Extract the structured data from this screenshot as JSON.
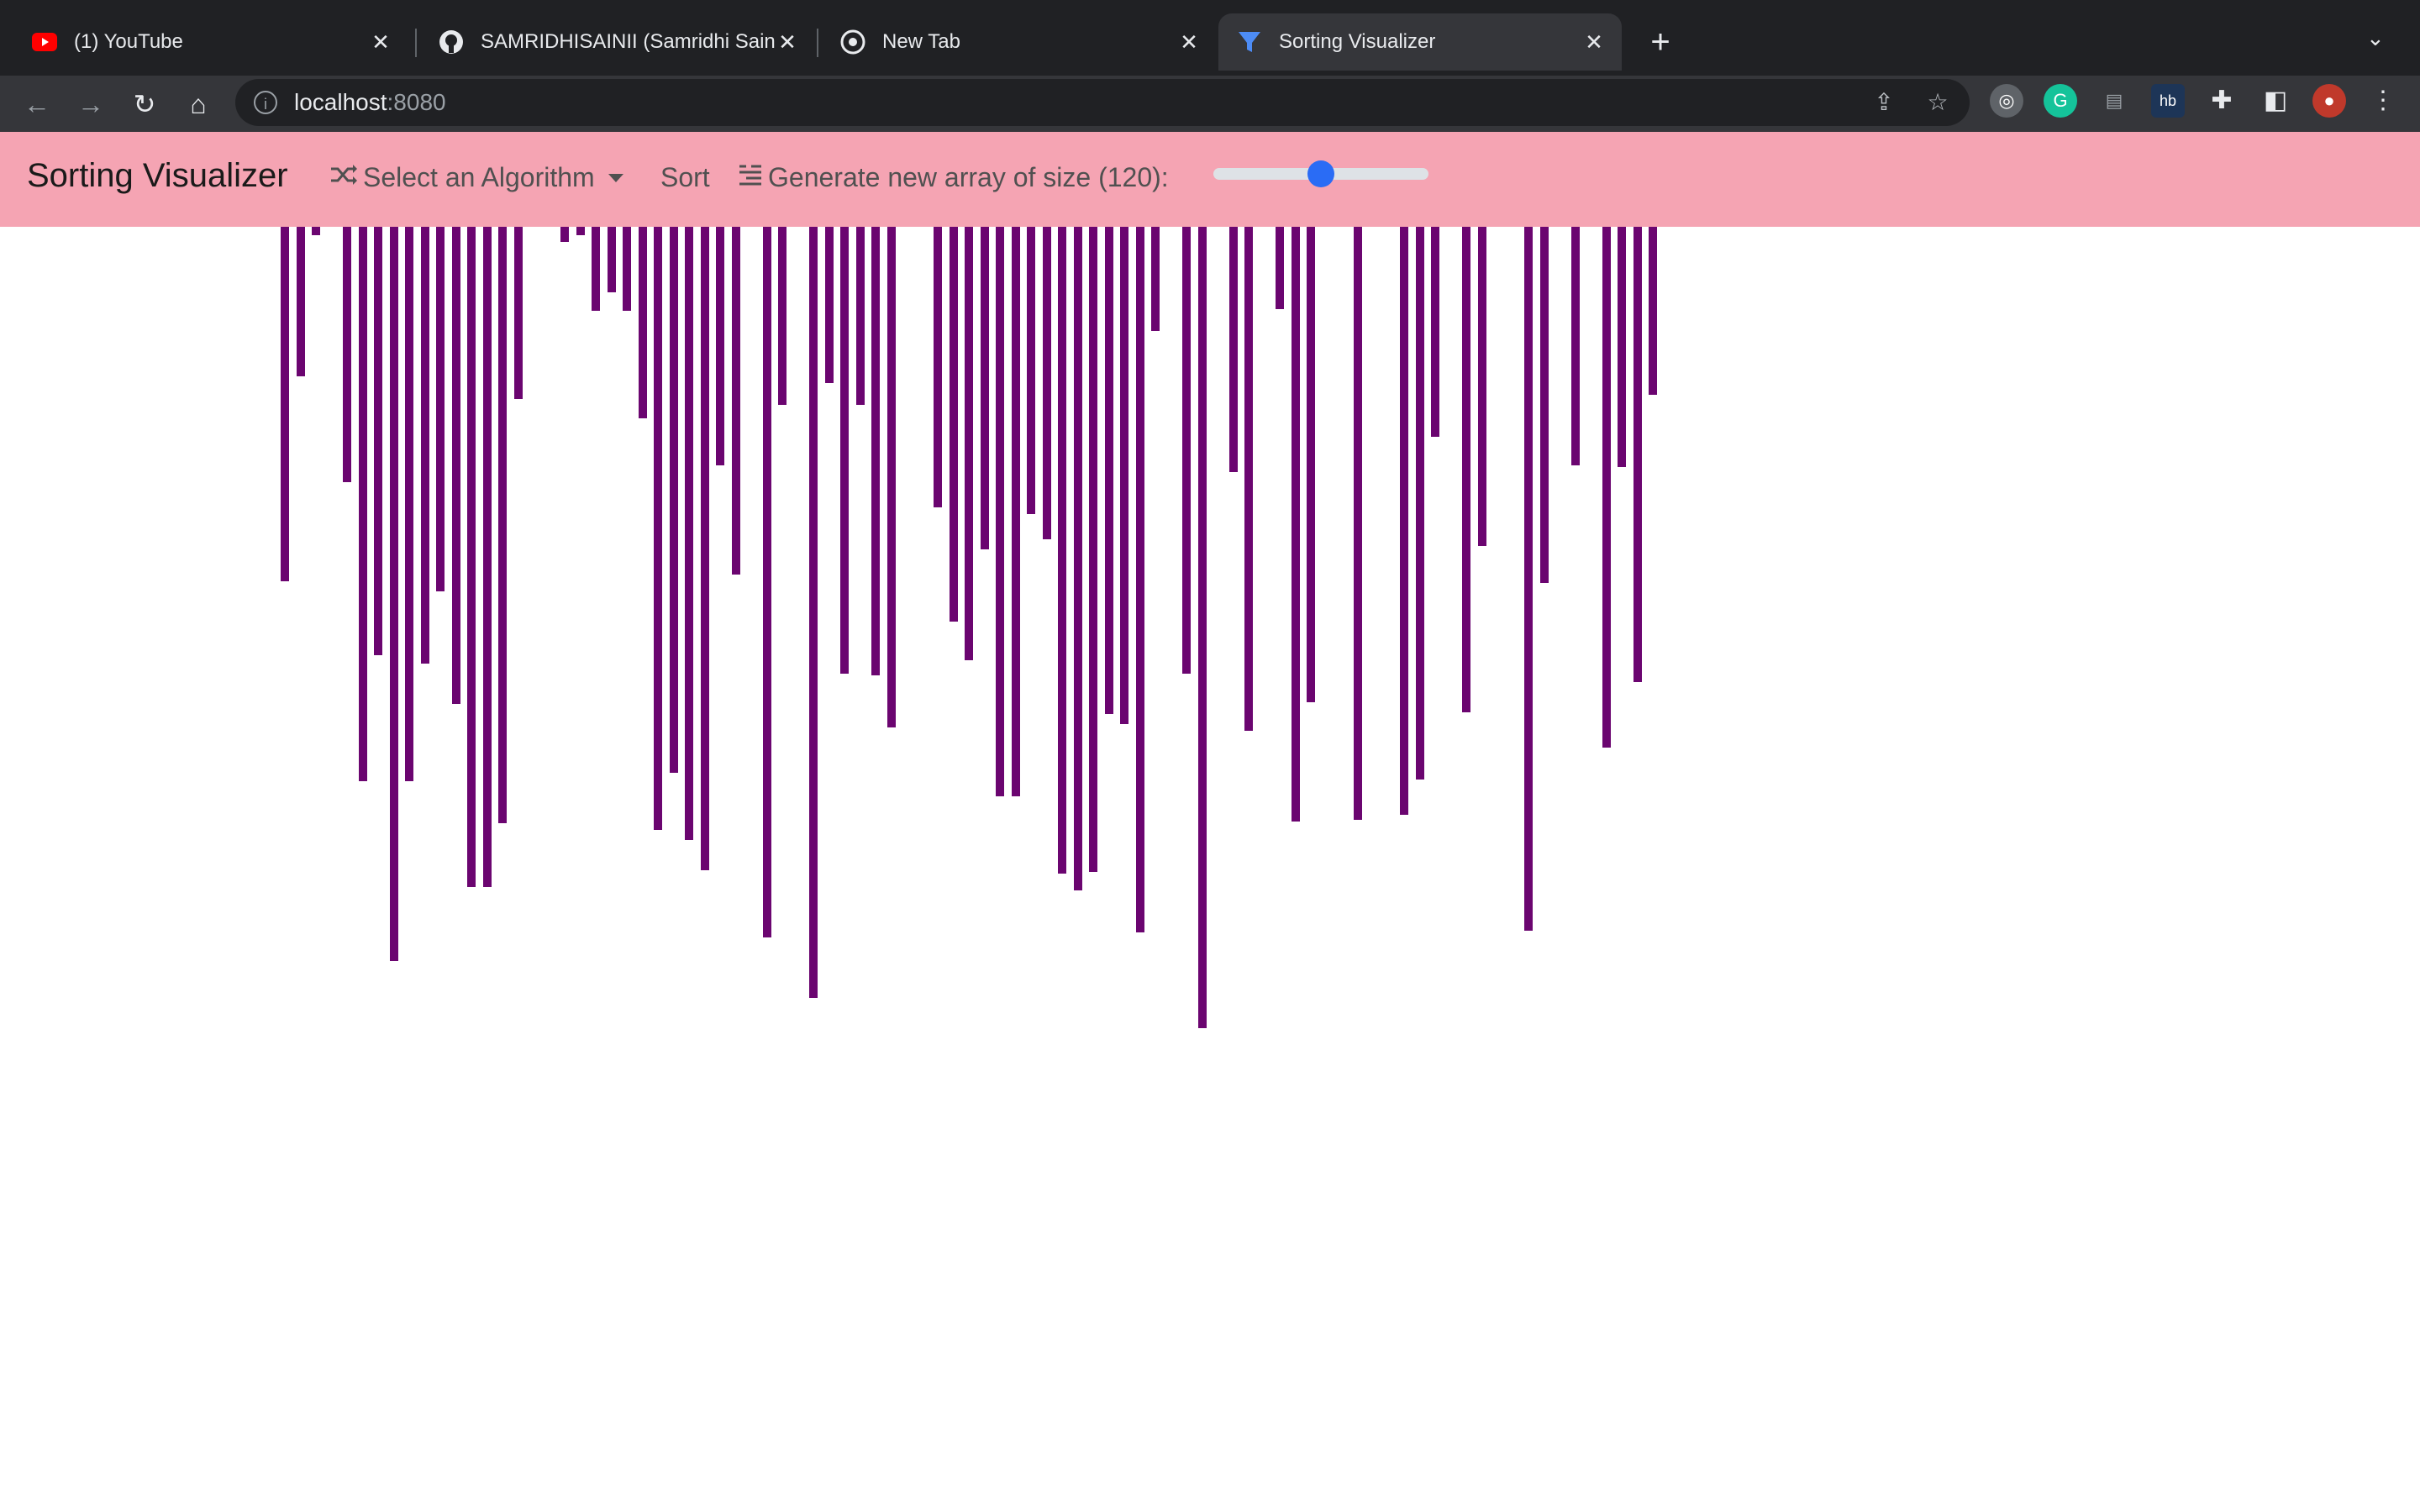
{
  "browser": {
    "tabs": [
      {
        "title": "(1) YouTube",
        "icon": "youtube-icon"
      },
      {
        "title": "SAMRIDHISAINII (Samridhi Saini)",
        "icon": "github-icon"
      },
      {
        "title": "New Tab",
        "icon": "chrome-icon"
      },
      {
        "title": "Sorting Visualizer",
        "icon": "funnel-icon"
      }
    ],
    "active_tab": 3,
    "url_host": "localhost",
    "url_port": ":8080"
  },
  "app": {
    "brand": "Sorting Visualizer",
    "algorithm_label": "Select an Algorithm",
    "sort_label": "Sort",
    "generate_label": "Generate new array of size (120):",
    "array_size": 120,
    "slider_fraction": 0.5,
    "bar_color": "#6b0570",
    "navbar_color": "#f5a4b3",
    "bar_values": [
      422,
      178,
      10,
      0,
      304,
      660,
      510,
      874,
      660,
      520,
      434,
      568,
      786,
      786,
      710,
      205,
      0,
      0,
      18,
      10,
      100,
      78,
      100,
      228,
      718,
      650,
      730,
      766,
      284,
      414,
      0,
      846,
      212,
      0,
      918,
      186,
      532,
      212,
      534,
      596,
      0,
      0,
      334,
      470,
      516,
      384,
      678,
      678,
      342,
      372,
      770,
      790,
      768,
      580,
      592,
      840,
      124,
      0,
      532,
      954,
      0,
      292,
      600,
      0,
      98,
      708,
      566,
      0,
      0,
      706,
      0,
      0,
      700,
      658,
      250,
      0,
      578,
      380,
      0,
      0,
      838,
      424,
      0,
      284,
      0,
      620,
      286,
      542,
      200,
      0,
      0,
      0,
      0,
      0,
      0,
      0,
      0,
      0,
      0,
      0,
      0,
      0,
      0,
      0,
      0,
      0,
      0,
      0,
      0,
      0,
      0,
      0,
      0,
      0,
      0,
      0,
      0,
      0,
      0,
      0
    ]
  }
}
